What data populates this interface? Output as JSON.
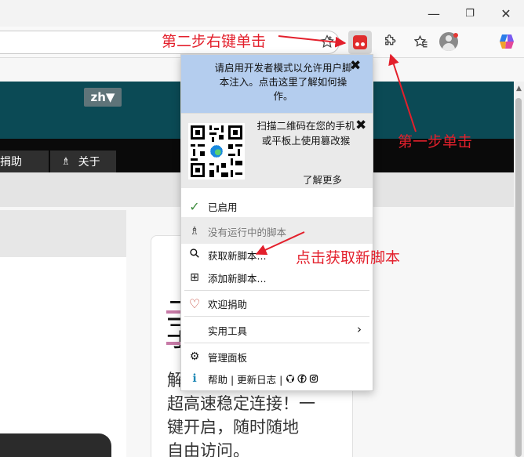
{
  "browser": {
    "window_controls": {
      "minimize": "—",
      "maximize": "❐",
      "close": "✕"
    },
    "toolbar": {
      "favorite_icon": "star-outline-icon",
      "extension_icon": "puzzle-icon",
      "favorites_icon": "favorites-icon",
      "profile_icon": "avatar",
      "copilot_icon": "copilot-icon"
    }
  },
  "page": {
    "language_button": "zh▼",
    "nav_tabs": [
      {
        "label": "捐助"
      },
      {
        "icon": "♗",
        "label": "关于"
      }
    ],
    "card": {
      "title_line1": "二",
      "title_line2": "子",
      "body_lines": [
        "解",
        "超高速稳定连接！一",
        "键开启，随时随地",
        "自由访问。"
      ]
    }
  },
  "popup": {
    "notice_developer": "请启用开发者模式以允许用户脚本注入。点击这里了解如何操作。",
    "notice_qr": "扫描二维码在您的手机或平板上使用篡改猴",
    "notice_qr_more": "了解更多",
    "close_symbol": "✖",
    "menu": {
      "enabled": {
        "icon": "✓",
        "label": "已启用"
      },
      "no_scripts": {
        "icon": "♗",
        "label": "没有运行中的脚本"
      },
      "get_new": {
        "icon": "⚲",
        "label": "获取新脚本..."
      },
      "add_new": {
        "icon": "⊞",
        "label": "添加新脚本..."
      },
      "donate": {
        "icon": "♡",
        "label": "欢迎捐助"
      },
      "utilities": {
        "label": "实用工具",
        "chevron": "›"
      },
      "dashboard": {
        "icon": "⚙",
        "label": "管理面板"
      },
      "help": {
        "icon": "ℹ",
        "label": "帮助 | 更新日志 |"
      }
    }
  },
  "annotations": {
    "step2": "第二步右键单击",
    "step1": "第一步单击",
    "get_script": "点击获取新脚本"
  },
  "colors": {
    "annotation": "#e3202c",
    "tampermonkey_icon_bg": "#e02d2d",
    "banner": "#0b4a55",
    "notice_blue": "#b4cdee",
    "enabled_check": "#3d8b3d",
    "heart": "#c0392b"
  }
}
